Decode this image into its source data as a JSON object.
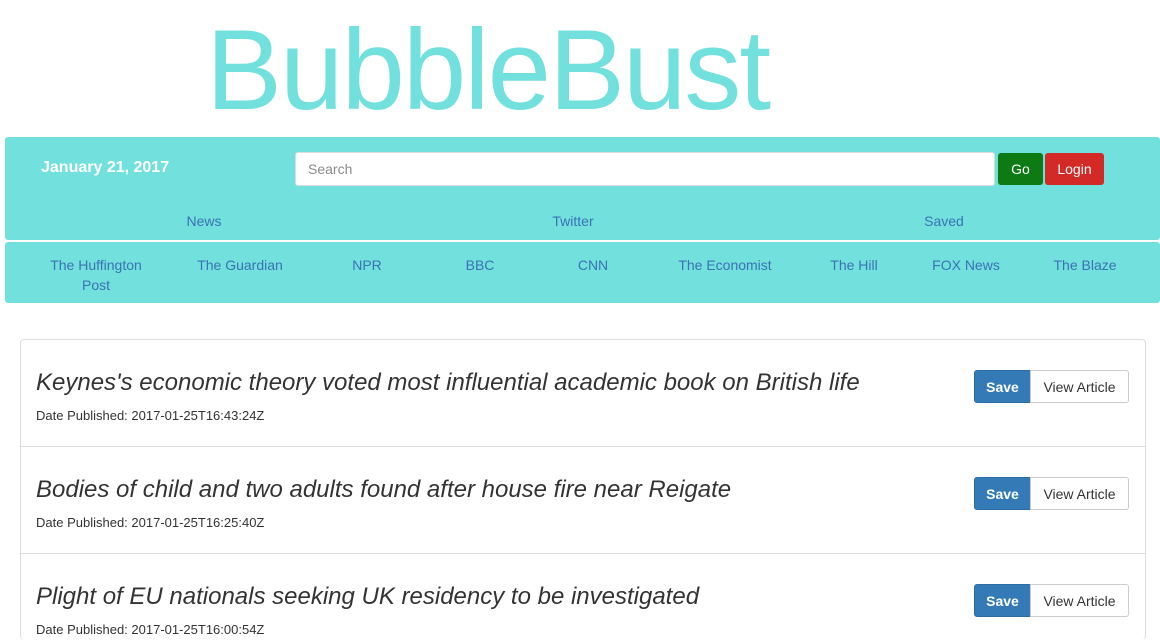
{
  "brand": {
    "name": "BubbleBust"
  },
  "colors": {
    "accent": "#72e0dc",
    "link": "#3a72b4",
    "go_button": "#0d7a14",
    "login_button": "#d42a27",
    "save_button": "#337ab7"
  },
  "header": {
    "date": "January 21, 2017",
    "search": {
      "placeholder": "Search",
      "value": ""
    },
    "go_label": "Go",
    "login_label": "Login"
  },
  "primary_nav": [
    {
      "label": "News"
    },
    {
      "label": "Twitter"
    },
    {
      "label": "Saved"
    }
  ],
  "sources": [
    {
      "label": "The Huffington Post"
    },
    {
      "label": "The Guardian"
    },
    {
      "label": "NPR"
    },
    {
      "label": "BBC"
    },
    {
      "label": "CNN"
    },
    {
      "label": "The Economist"
    },
    {
      "label": "The Hill"
    },
    {
      "label": "FOX News"
    },
    {
      "label": "The Blaze"
    }
  ],
  "articles": [
    {
      "title": "Keynes's economic theory voted most influential academic book on British life",
      "date": "Date Published: 2017-01-25T16:43:24Z",
      "save_label": "Save",
      "view_label": "View Article"
    },
    {
      "title": "Bodies of child and two adults found after house fire near Reigate",
      "date": "Date Published: 2017-01-25T16:25:40Z",
      "save_label": "Save",
      "view_label": "View Article"
    },
    {
      "title": "Plight of EU nationals seeking UK residency to be investigated",
      "date": "Date Published: 2017-01-25T16:00:54Z",
      "save_label": "Save",
      "view_label": "View Article"
    }
  ]
}
